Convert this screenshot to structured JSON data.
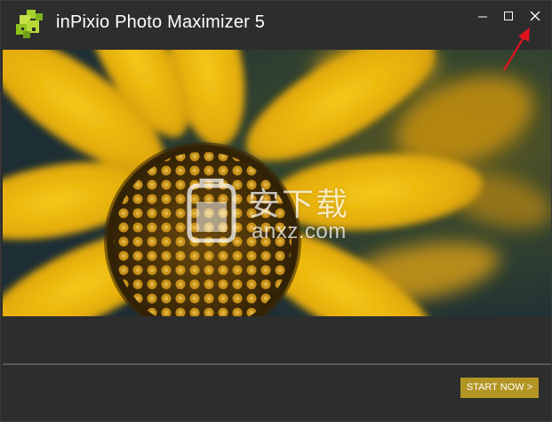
{
  "window": {
    "title": "inPixio Photo Maximizer 5",
    "controls": {
      "minimize_icon": "minimize-icon",
      "maximize_icon": "maximize-icon",
      "close_icon": "close-icon"
    }
  },
  "hero": {
    "image_subject": "yellow flower",
    "watermark_text": "安下载",
    "watermark_sub": "anxz.com"
  },
  "footer": {
    "start_label": "START NOW >"
  },
  "colors": {
    "background": "#2d2d2d",
    "accent": "#b39524",
    "logo_green": "#9acd32",
    "annotation_red": "#e0141e"
  }
}
